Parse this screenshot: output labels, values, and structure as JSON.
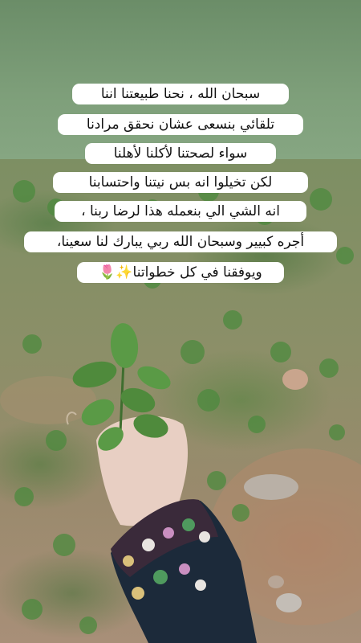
{
  "caption": {
    "lines": [
      "سبحان الله ، نحنا طبيعتنا اننا",
      "تلقائي بنسعى عشان نحقق مرادنا",
      "سواء لصحتنا لأكلنا لأهلنا",
      "لكن تخيلوا انه بس نيتنا واحتسابنا",
      "انه الشي الي بنعمله هذا  لرضا ربنا ،",
      "أجره كبيير وسبحان الله ربي يبارك لنا سعينا،",
      "ويوفقنا في كل خطواتنا✨🌷"
    ]
  },
  "colors": {
    "top_band": "#7e9f7a",
    "caption_background": "#ffffff",
    "caption_text": "#111111",
    "mint_leaf": "#4f8a3c",
    "sleeve": "#1c2a3a"
  }
}
